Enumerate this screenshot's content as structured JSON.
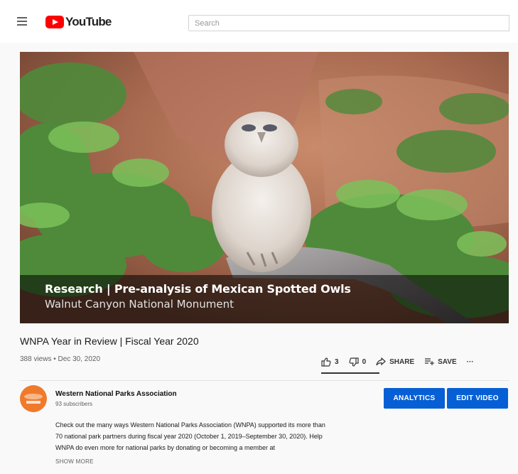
{
  "header": {
    "logo_text": "YouTube",
    "search_placeholder": "Search"
  },
  "video": {
    "overlay_title": "Research | Pre-analysis of Mexican Spotted Owls",
    "overlay_subtitle": "Walnut Canyon National Monument",
    "title": "WNPA Year in Review | Fiscal Year 2020",
    "meta": "388 views • Dec 30, 2020"
  },
  "actions": {
    "likes": "3",
    "dislikes": "0",
    "share_label": "SHARE",
    "save_label": "SAVE",
    "more_label": "···",
    "like_ratio": 1.0
  },
  "channel": {
    "name": "Western National Parks Association",
    "subscribers": "93 subscribers",
    "analytics_label": "ANALYTICS",
    "edit_label": "EDIT VIDEO"
  },
  "description": {
    "line1": "Check out the many ways Western National Parks Association (WNPA) supported its more than",
    "line2": "70 national park partners during fiscal year 2020 (October 1, 2019–September 30, 2020). Help",
    "line3": "WNPA do even more for national parks by donating or becoming a member at",
    "show_more": "SHOW MORE"
  },
  "colors": {
    "brand_red": "#ff0000",
    "button_blue": "#065fd4",
    "avatar_orange": "#f07a2b"
  }
}
